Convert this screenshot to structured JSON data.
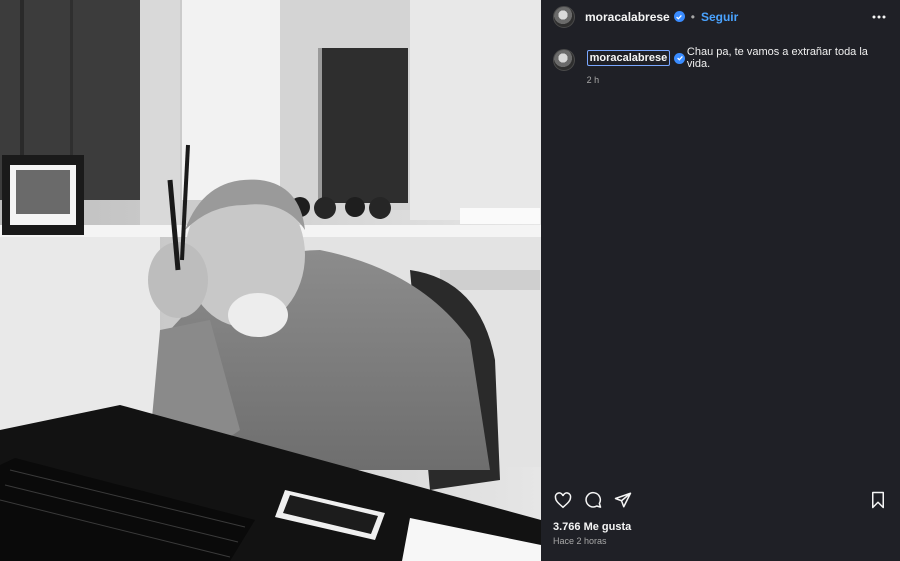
{
  "post": {
    "author": "moracalabrese",
    "follow_label": "Seguir",
    "separator": "•",
    "caption_user": "moracalabrese",
    "caption_text": "Chau pa, te vamos a extrañar toda la vida.",
    "caption_age": "2 h",
    "likes": "3.766 Me gusta",
    "posted": "Hace 2 horas",
    "verified_color": "#3a8cff",
    "link_color": "#4aa3ff"
  },
  "icons": {
    "like": "heart-icon",
    "comment": "comment-icon",
    "share": "send-icon",
    "save": "bookmark-icon",
    "more": "more-options-icon"
  }
}
